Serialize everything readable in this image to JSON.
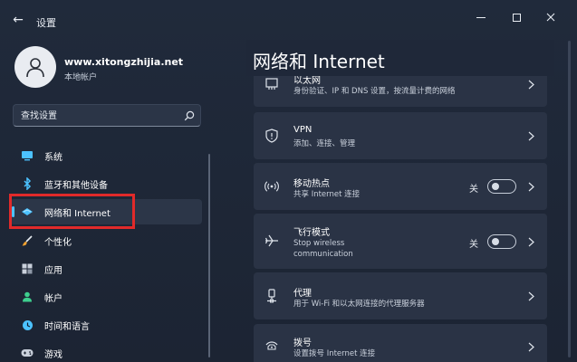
{
  "window": {
    "title": "设置",
    "back_icon": "arrow-left-icon",
    "controls": [
      "minimize-icon",
      "maximize-icon",
      "close-icon"
    ]
  },
  "profile": {
    "name": "www.xitongzhijia.net",
    "account_type": "本地帐户"
  },
  "search": {
    "placeholder": "查找设置"
  },
  "sidebar": {
    "items": [
      {
        "label": "系统",
        "icon": "monitor-icon",
        "color": "#4cc2ff"
      },
      {
        "label": "蓝牙和其他设备",
        "icon": "bluetooth-icon",
        "color": "#4cc2ff"
      },
      {
        "label": "网络和 Internet",
        "icon": "wifi-diamond-icon",
        "color": "#4cc2ff",
        "selected": true
      },
      {
        "label": "个性化",
        "icon": "brush-icon",
        "color": "#f0a030"
      },
      {
        "label": "应用",
        "icon": "apps-grid-icon",
        "color": "#c9d0db"
      },
      {
        "label": "帐户",
        "icon": "person-icon",
        "color": "#3ecf8e"
      },
      {
        "label": "时间和语言",
        "icon": "globe-clock-icon",
        "color": "#4cc2ff"
      },
      {
        "label": "游戏",
        "icon": "gamepad-icon",
        "color": "#c9d0db"
      }
    ]
  },
  "main": {
    "title": "网络和 Internet",
    "cards": [
      {
        "title": "以太网",
        "subtitle": "身份验证、IP 和 DNS 设置，按流量计费的网络",
        "icon": "ethernet-icon"
      },
      {
        "title": "VPN",
        "subtitle": "添加、连接、管理",
        "icon": "shield-icon"
      },
      {
        "title": "移动热点",
        "subtitle": "共享 Internet 连接",
        "icon": "hotspot-icon",
        "toggle": {
          "label": "关",
          "on": false
        }
      },
      {
        "title": "飞行模式",
        "subtitle_lines": [
          "Stop wireless",
          "communication"
        ],
        "icon": "airplane-icon",
        "toggle": {
          "label": "关",
          "on": false
        }
      },
      {
        "title": "代理",
        "subtitle": "用于 Wi-Fi 和以太网连接的代理服务器",
        "icon": "proxy-icon"
      },
      {
        "title": "拨号",
        "subtitle": "设置拨号 Internet 连接",
        "icon": "dialup-icon"
      }
    ]
  },
  "colors": {
    "accent": "#4cc2ff",
    "highlight": "#e12a2a",
    "card_bg": "#2a3345",
    "window_bg": "#1e2738"
  }
}
